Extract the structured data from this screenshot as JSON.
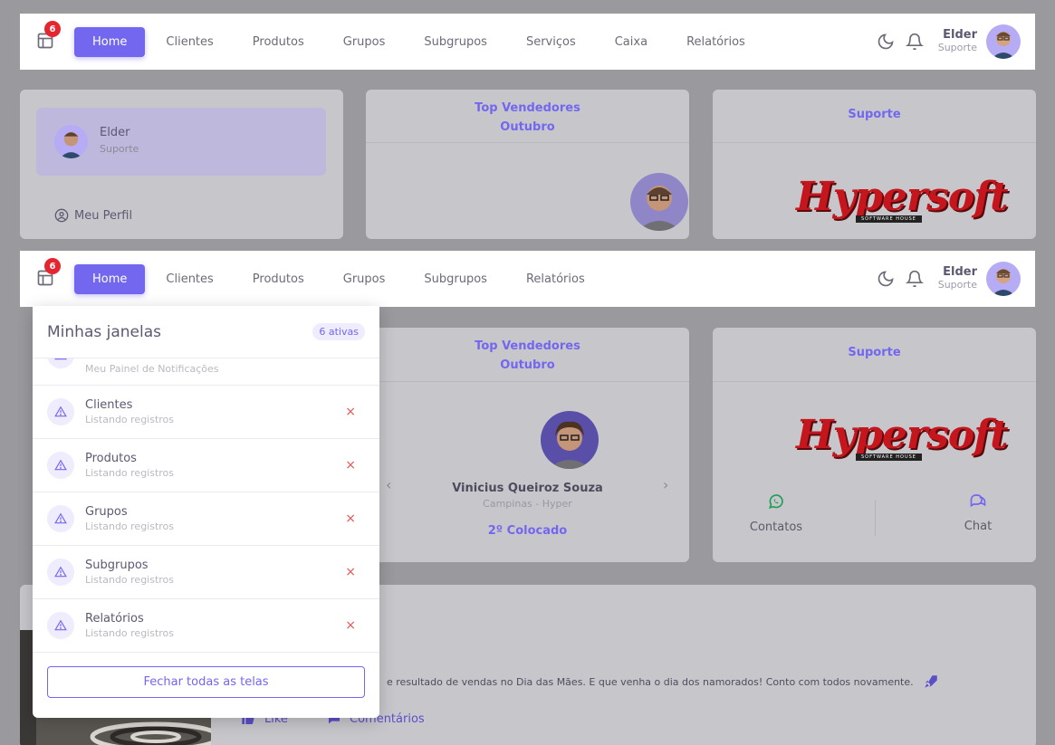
{
  "nav_top": {
    "badge": "6",
    "items": [
      "Home",
      "Clientes",
      "Produtos",
      "Grupos",
      "Subgrupos",
      "Serviços",
      "Caixa",
      "Relatórios"
    ],
    "user_name": "Elder",
    "user_role": "Suporte"
  },
  "nav_bottom": {
    "badge": "6",
    "items": [
      "Home",
      "Clientes",
      "Produtos",
      "Grupos",
      "Subgrupos",
      "Relatórios"
    ],
    "user_name": "Elder",
    "user_role": "Suporte"
  },
  "profile_card": {
    "name": "Elder",
    "role": "Suporte",
    "link": "Meu Perfil"
  },
  "top_sellers": {
    "title_line1": "Top Vendedores",
    "title_line2": "Outubro",
    "seller_name": "Vinicius Queiroz Souza",
    "seller_location": "Campinas - Hyper",
    "rank": "2º Colocado"
  },
  "support_card": {
    "title": "Suporte",
    "logo_text": "Hypersoft",
    "logo_subtext": "SOFTWARE HOUSE",
    "contacts_label": "Contatos",
    "chat_label": "Chat"
  },
  "post": {
    "text": "e resultado de vendas no Dia das Mães. E que venha o dia dos namorados! Conto com todos novamente.",
    "like_label": "Like",
    "comments_label": "Comentários"
  },
  "windows_panel": {
    "title": "Minhas janelas",
    "badge": "6 ativas",
    "partial_item_sub": "Meu Painel de Notificações",
    "items": [
      {
        "title": "Clientes",
        "subtitle": "Listando registros"
      },
      {
        "title": "Produtos",
        "subtitle": "Listando registros"
      },
      {
        "title": "Grupos",
        "subtitle": "Listando registros"
      },
      {
        "title": "Subgrupos",
        "subtitle": "Listando registros"
      },
      {
        "title": "Relatórios",
        "subtitle": "Listando registros"
      }
    ],
    "close_symbol": "×",
    "close_all_label": "Fechar todas as telas"
  },
  "colors": {
    "accent": "#7367f0",
    "danger": "#ea5455",
    "overlay_bg": "#9a9a9e",
    "whatsapp": "#28c76f"
  },
  "icons": [
    "layout-icon",
    "moon-icon",
    "bell-icon",
    "user-circle-icon",
    "alert-triangle-icon",
    "close-icon",
    "chevron-left-icon",
    "chevron-right-icon",
    "whatsapp-icon",
    "chat-icon",
    "rocket-icon",
    "thumbs-up-icon",
    "comment-icon"
  ]
}
